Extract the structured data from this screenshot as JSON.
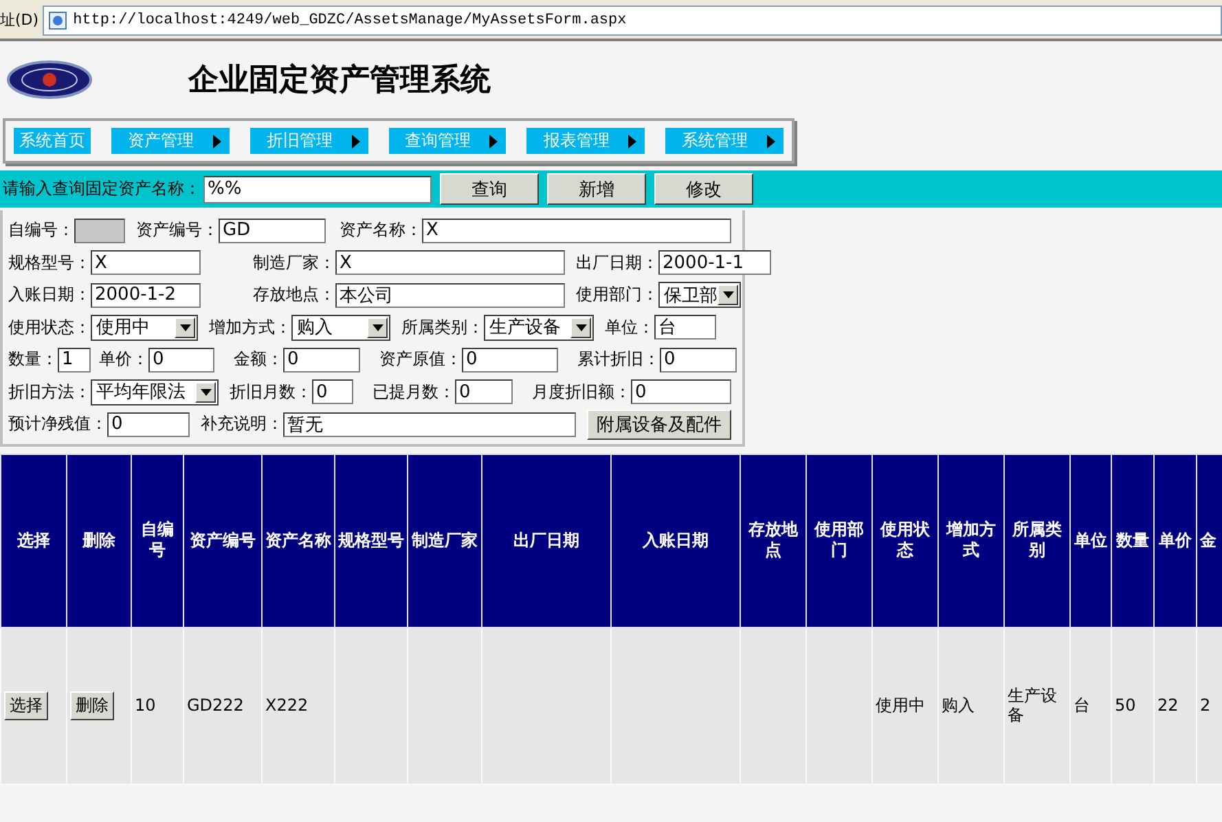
{
  "browser": {
    "address_label": "址(D)",
    "url": "http://localhost:4249/web_GDZC/AssetsManage/MyAssetsForm.aspx"
  },
  "header": {
    "title": "企业固定资产管理系统"
  },
  "nav": [
    {
      "label": "系统首页",
      "has_submenu": false
    },
    {
      "label": "资产管理",
      "has_submenu": true
    },
    {
      "label": "折旧管理",
      "has_submenu": true
    },
    {
      "label": "查询管理",
      "has_submenu": true
    },
    {
      "label": "报表管理",
      "has_submenu": true
    },
    {
      "label": "系统管理",
      "has_submenu": true
    }
  ],
  "search": {
    "label": "请输入查询固定资产名称：",
    "value": "%%",
    "buttons": [
      "查询",
      "新增",
      "修改"
    ]
  },
  "form": {
    "rows": [
      {
        "fields": [
          {
            "label": "自编号：",
            "kind": "disabled"
          },
          {
            "label": "资产编号：",
            "kind": "text",
            "value": "GD"
          },
          {
            "label": "资产名称：",
            "kind": "text",
            "value": "X"
          }
        ]
      },
      {
        "fields": [
          {
            "label": "规格型号：",
            "kind": "text",
            "value": "X"
          },
          {
            "label": "制造厂家：",
            "kind": "text",
            "value": "X"
          },
          {
            "label": "出厂日期：",
            "kind": "text",
            "value": "2000-1-1"
          }
        ]
      },
      {
        "fields": [
          {
            "label": "入账日期：",
            "kind": "text",
            "value": "2000-1-2"
          },
          {
            "label": "存放地点：",
            "kind": "text",
            "value": "本公司"
          },
          {
            "label": "使用部门：",
            "kind": "select",
            "value": "保卫部"
          }
        ]
      },
      {
        "fields": [
          {
            "label": "使用状态：",
            "kind": "select",
            "value": "使用中"
          },
          {
            "label": "增加方式：",
            "kind": "select",
            "value": "购入"
          },
          {
            "label": "所属类别：",
            "kind": "select",
            "value": "生产设备"
          },
          {
            "label": "单位：",
            "kind": "text",
            "value": "台"
          }
        ]
      },
      {
        "fields": [
          {
            "label": "数量：",
            "kind": "text",
            "value": "1"
          },
          {
            "label": "单价：",
            "kind": "text",
            "value": "0"
          },
          {
            "label": "金额：",
            "kind": "text",
            "value": "0"
          },
          {
            "label": "资产原值：",
            "kind": "text",
            "value": "0"
          },
          {
            "label": "累计折旧：",
            "kind": "text",
            "value": "0"
          }
        ]
      },
      {
        "fields": [
          {
            "label": "折旧方法：",
            "kind": "select",
            "value": "平均年限法"
          },
          {
            "label": "折旧月数：",
            "kind": "text",
            "value": "0"
          },
          {
            "label": "已提月数：",
            "kind": "text",
            "value": "0"
          },
          {
            "label": "月度折旧额：",
            "kind": "text",
            "value": "0"
          }
        ]
      },
      {
        "fields": [
          {
            "label": "预计净残值：",
            "kind": "text",
            "value": "0"
          },
          {
            "label": "补充说明：",
            "kind": "text",
            "value": "暂无"
          }
        ]
      }
    ],
    "extra_button": "附属设备及配件"
  },
  "table": {
    "columns": [
      "选择",
      "删除",
      "自编号",
      "资产编号",
      "资产名称",
      "规格型号",
      "制造厂家",
      "出厂日期",
      "入账日期",
      "存放地点",
      "使用部门",
      "使用状态",
      "增加方式",
      "所属类别",
      "单位",
      "数量",
      "单价",
      "金"
    ],
    "rows": [
      {
        "cells": [
          {
            "kind": "button",
            "text": "选择"
          },
          {
            "kind": "button",
            "text": "删除"
          },
          {
            "kind": "text",
            "text": "10"
          },
          {
            "kind": "text",
            "text": "GD222"
          },
          {
            "kind": "text",
            "text": "X222"
          },
          {
            "kind": "text",
            "text": ""
          },
          {
            "kind": "text",
            "text": ""
          },
          {
            "kind": "text",
            "text": ""
          },
          {
            "kind": "text",
            "text": ""
          },
          {
            "kind": "text",
            "text": ""
          },
          {
            "kind": "text",
            "text": ""
          },
          {
            "kind": "text",
            "text": "使用中"
          },
          {
            "kind": "text",
            "text": "购入"
          },
          {
            "kind": "text",
            "text": "生产设备"
          },
          {
            "kind": "text",
            "text": "台"
          },
          {
            "kind": "text",
            "text": "50"
          },
          {
            "kind": "text",
            "text": "22"
          },
          {
            "kind": "text",
            "text": "2"
          }
        ]
      }
    ]
  }
}
